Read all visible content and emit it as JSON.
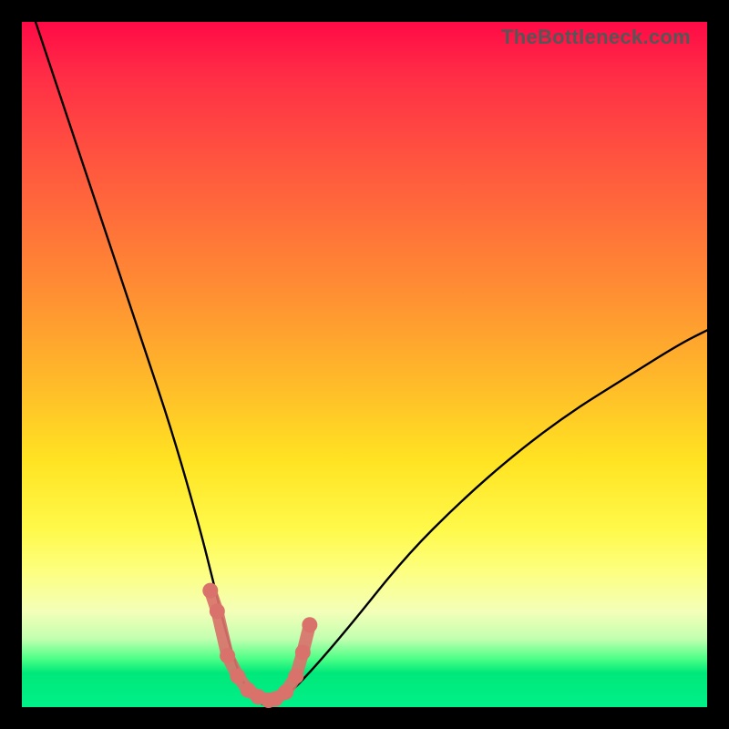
{
  "attribution": "TheBottleneck.com",
  "chart_data": {
    "type": "line",
    "title": "",
    "xlabel": "",
    "ylabel": "",
    "ylim": [
      0,
      100
    ],
    "xlim": [
      0,
      100
    ],
    "series": [
      {
        "name": "bottleneck-curve",
        "x": [
          2,
          6,
          10,
          14,
          18,
          22,
          26,
          28,
          30,
          32,
          34,
          36,
          38,
          42,
          48,
          56,
          64,
          72,
          80,
          88,
          96,
          100
        ],
        "values": [
          100,
          88,
          76,
          64,
          52,
          40,
          26,
          18,
          10,
          4,
          1,
          0,
          1,
          5,
          12,
          22,
          30,
          37,
          43,
          48,
          53,
          55
        ]
      }
    ],
    "markers": {
      "name": "trough-markers",
      "color": "#d9726b",
      "x": [
        27.5,
        28.5,
        30,
        31.5,
        33,
        34.5,
        36,
        37,
        38.5,
        40,
        41,
        42
      ],
      "values": [
        17,
        14,
        7.5,
        4.5,
        2.5,
        1.5,
        1.0,
        1.2,
        2.2,
        4.5,
        8,
        12
      ]
    }
  },
  "colors": {
    "curve": "#000000",
    "marker": "#d9726b",
    "frame": "#000000"
  }
}
